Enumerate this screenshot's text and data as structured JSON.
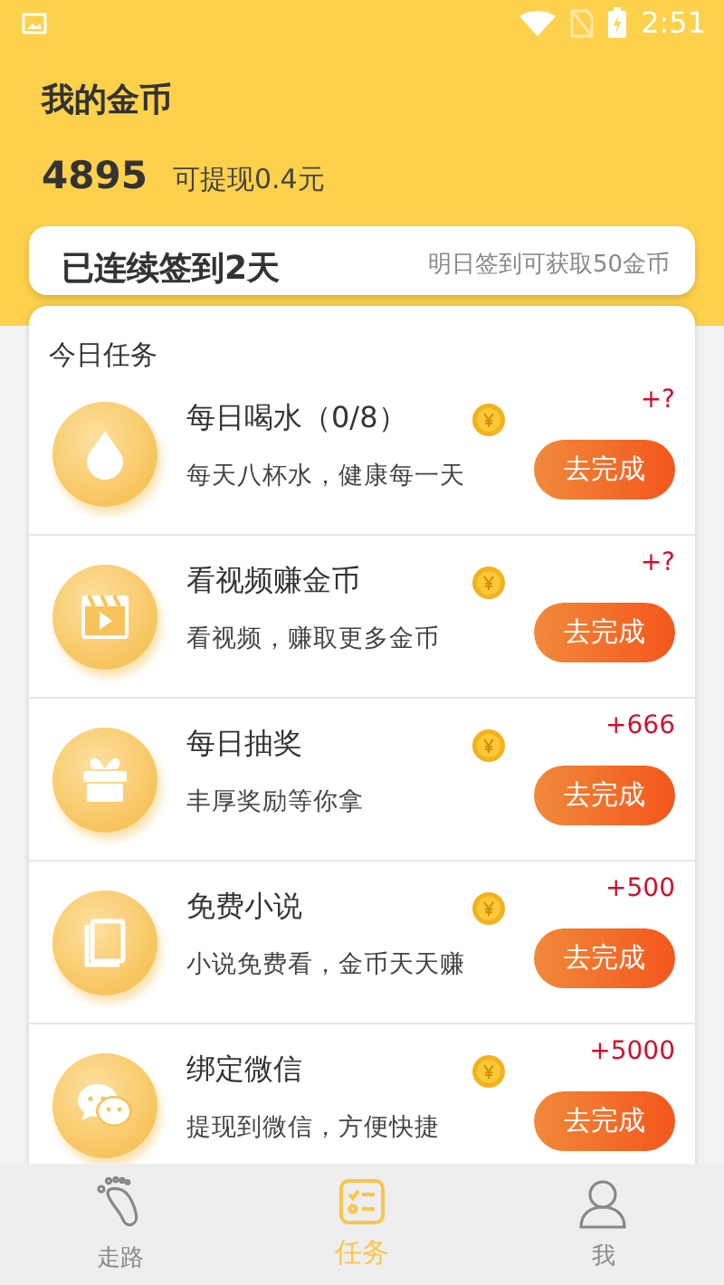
{
  "status_bar": {
    "time": "2:51"
  },
  "header": {
    "title": "我的金币",
    "coins": "4895",
    "withdrawable": "可提现0.4元"
  },
  "checkin": {
    "streak": "已连续签到2天",
    "tomorrow": "明日签到可获取50金币"
  },
  "tasks": {
    "title": "今日任务",
    "items": [
      {
        "kind": "water",
        "title": "每日喝水（0/8）",
        "desc": "每天八杯水，健康每一天",
        "reward": "+?",
        "button": "去完成"
      },
      {
        "kind": "video",
        "title": "看视频赚金币",
        "desc": "看视频，赚取更多金币",
        "reward": "+?",
        "button": "去完成"
      },
      {
        "kind": "gift",
        "title": "每日抽奖",
        "desc": "丰厚奖励等你拿",
        "reward": "+666",
        "button": "去完成"
      },
      {
        "kind": "book",
        "title": "免费小说",
        "desc": "小说免费看，金币天天赚",
        "reward": "+500",
        "button": "去完成"
      },
      {
        "kind": "chat",
        "title": "绑定微信",
        "desc": "提现到微信，方便快捷",
        "reward": "+5000",
        "button": "去完成"
      }
    ]
  },
  "bottom_nav": [
    {
      "kind": "walk",
      "label": "走路",
      "selected": false
    },
    {
      "kind": "tasks",
      "label": "任务",
      "selected": true
    },
    {
      "kind": "me",
      "label": "我",
      "selected": false
    }
  ]
}
